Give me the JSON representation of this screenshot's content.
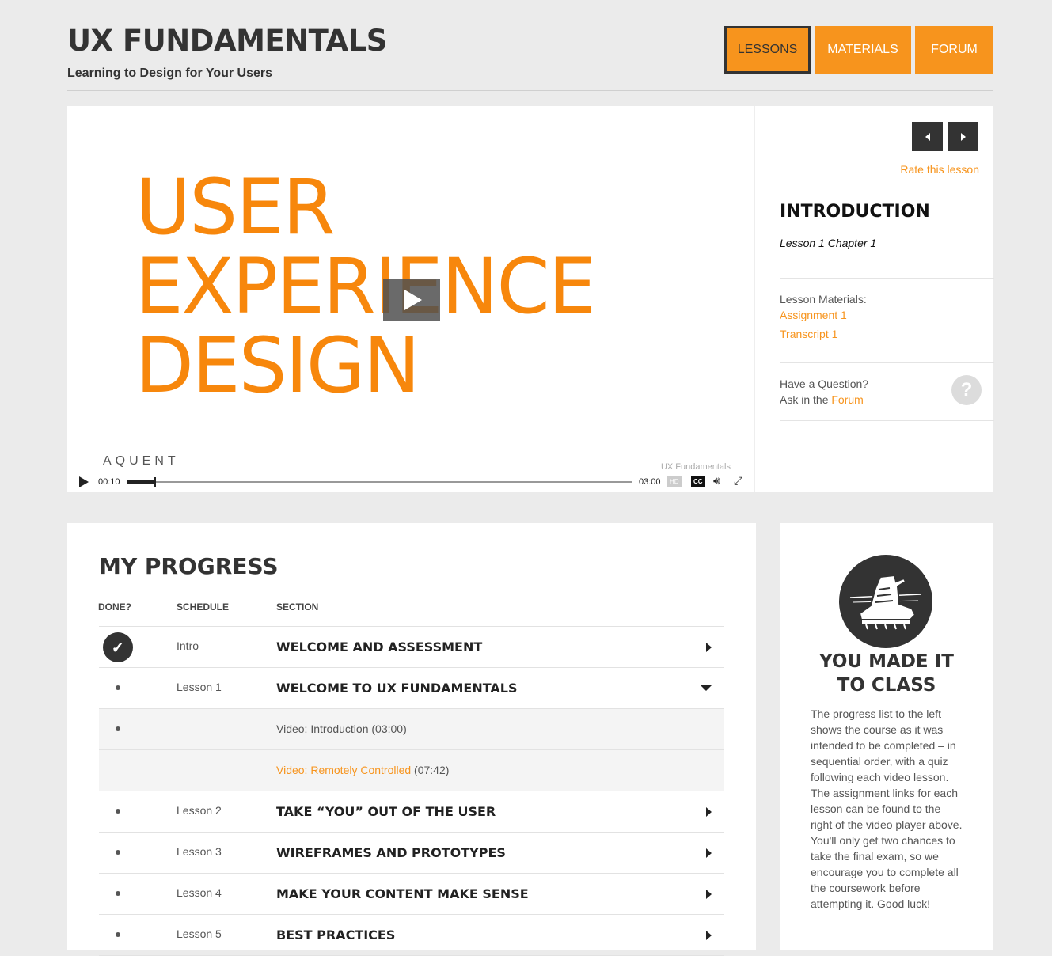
{
  "header": {
    "title": "UX FUNDAMENTALS",
    "subtitle": "Learning to Design for Your Users",
    "nav": [
      {
        "label": "LESSONS",
        "active": true
      },
      {
        "label": "MATERIALS",
        "active": false
      },
      {
        "label": "FORUM",
        "active": false
      }
    ]
  },
  "video": {
    "title_lines": [
      "USER",
      "EXPERIENCE",
      "DESIGN"
    ],
    "brand": "AQUENT",
    "footer_text": "UX Fundamentals",
    "current_time": "00:10",
    "duration": "03:00",
    "progress_fraction": 0.055,
    "hd_label": "HD",
    "cc_label": "CC"
  },
  "lesson": {
    "rate_label": "Rate this lesson",
    "title": "INTRODUCTION",
    "subtitle": "Lesson 1 Chapter 1",
    "materials_label": "Lesson Materials:",
    "materials": [
      "Assignment 1",
      "Transcript 1"
    ],
    "question_label": "Have a Question?",
    "ask_prefix": "Ask in the ",
    "ask_link": "Forum",
    "question_mark": "?"
  },
  "progress": {
    "title": "MY PROGRESS",
    "headers": {
      "done": "DONE?",
      "schedule": "SCHEDULE",
      "section": "SECTION"
    },
    "rows": [
      {
        "schedule": "Intro",
        "section": "WELCOME AND ASSESSMENT"
      },
      {
        "schedule": "Lesson 1",
        "section": "WELCOME TO UX FUNDAMENTALS"
      },
      {
        "text": "Video: Introduction (03:00)"
      },
      {
        "link": "Video: Remotely Controlled",
        "text": " (07:42)"
      },
      {
        "schedule": "Lesson 2",
        "section": "TAKE “YOU” OUT OF THE USER"
      },
      {
        "schedule": "Lesson 3",
        "section": "WIREFRAMES AND PROTOTYPES"
      },
      {
        "schedule": "Lesson 4",
        "section": "MAKE YOUR CONTENT MAKE SENSE"
      },
      {
        "schedule": "Lesson 5",
        "section": "BEST PRACTICES"
      }
    ]
  },
  "badge": {
    "icon": "boot-icon",
    "title_line1": "YOU MADE IT",
    "title_line2": "TO CLASS",
    "text": "The progress list to the left shows the course as it was intended to be completed – in sequential order, with a quiz following each video lesson. The assignment links for each lesson can be found to the right of the video player above. You'll only get two chances to take the final exam, so we encourage you to complete all the coursework before attempting it. Good luck!"
  },
  "colors": {
    "accent": "#f7941d",
    "dark": "#333333",
    "video_title": "#f7870c"
  }
}
